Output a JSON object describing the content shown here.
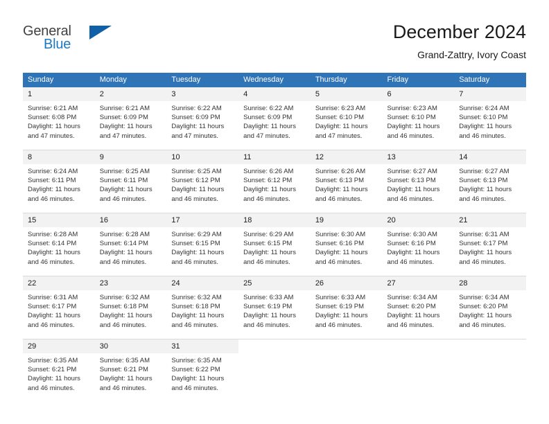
{
  "brand": {
    "name_top": "General",
    "name_bottom": "Blue",
    "triangle_color": "#1060a8",
    "blue_color": "#1c79c0",
    "gray_color": "#404040"
  },
  "header": {
    "title": "December 2024",
    "subtitle": "Grand-Zattry, Ivory Coast",
    "accent_color": "#3074b8",
    "daynum_band_color": "#f2f2f2"
  },
  "weekdays": [
    "Sunday",
    "Monday",
    "Tuesday",
    "Wednesday",
    "Thursday",
    "Friday",
    "Saturday"
  ],
  "labels": {
    "sunrise_prefix": "Sunrise: ",
    "sunset_prefix": "Sunset: ",
    "daylight_prefix": "Daylight: "
  },
  "weeks": [
    [
      {
        "day": "1",
        "sunrise": "Sunrise: 6:21 AM",
        "sunset": "Sunset: 6:08 PM",
        "daylight_1": "Daylight: 11 hours",
        "daylight_2": "and 47 minutes."
      },
      {
        "day": "2",
        "sunrise": "Sunrise: 6:21 AM",
        "sunset": "Sunset: 6:09 PM",
        "daylight_1": "Daylight: 11 hours",
        "daylight_2": "and 47 minutes."
      },
      {
        "day": "3",
        "sunrise": "Sunrise: 6:22 AM",
        "sunset": "Sunset: 6:09 PM",
        "daylight_1": "Daylight: 11 hours",
        "daylight_2": "and 47 minutes."
      },
      {
        "day": "4",
        "sunrise": "Sunrise: 6:22 AM",
        "sunset": "Sunset: 6:09 PM",
        "daylight_1": "Daylight: 11 hours",
        "daylight_2": "and 47 minutes."
      },
      {
        "day": "5",
        "sunrise": "Sunrise: 6:23 AM",
        "sunset": "Sunset: 6:10 PM",
        "daylight_1": "Daylight: 11 hours",
        "daylight_2": "and 47 minutes."
      },
      {
        "day": "6",
        "sunrise": "Sunrise: 6:23 AM",
        "sunset": "Sunset: 6:10 PM",
        "daylight_1": "Daylight: 11 hours",
        "daylight_2": "and 46 minutes."
      },
      {
        "day": "7",
        "sunrise": "Sunrise: 6:24 AM",
        "sunset": "Sunset: 6:10 PM",
        "daylight_1": "Daylight: 11 hours",
        "daylight_2": "and 46 minutes."
      }
    ],
    [
      {
        "day": "8",
        "sunrise": "Sunrise: 6:24 AM",
        "sunset": "Sunset: 6:11 PM",
        "daylight_1": "Daylight: 11 hours",
        "daylight_2": "and 46 minutes."
      },
      {
        "day": "9",
        "sunrise": "Sunrise: 6:25 AM",
        "sunset": "Sunset: 6:11 PM",
        "daylight_1": "Daylight: 11 hours",
        "daylight_2": "and 46 minutes."
      },
      {
        "day": "10",
        "sunrise": "Sunrise: 6:25 AM",
        "sunset": "Sunset: 6:12 PM",
        "daylight_1": "Daylight: 11 hours",
        "daylight_2": "and 46 minutes."
      },
      {
        "day": "11",
        "sunrise": "Sunrise: 6:26 AM",
        "sunset": "Sunset: 6:12 PM",
        "daylight_1": "Daylight: 11 hours",
        "daylight_2": "and 46 minutes."
      },
      {
        "day": "12",
        "sunrise": "Sunrise: 6:26 AM",
        "sunset": "Sunset: 6:13 PM",
        "daylight_1": "Daylight: 11 hours",
        "daylight_2": "and 46 minutes."
      },
      {
        "day": "13",
        "sunrise": "Sunrise: 6:27 AM",
        "sunset": "Sunset: 6:13 PM",
        "daylight_1": "Daylight: 11 hours",
        "daylight_2": "and 46 minutes."
      },
      {
        "day": "14",
        "sunrise": "Sunrise: 6:27 AM",
        "sunset": "Sunset: 6:13 PM",
        "daylight_1": "Daylight: 11 hours",
        "daylight_2": "and 46 minutes."
      }
    ],
    [
      {
        "day": "15",
        "sunrise": "Sunrise: 6:28 AM",
        "sunset": "Sunset: 6:14 PM",
        "daylight_1": "Daylight: 11 hours",
        "daylight_2": "and 46 minutes."
      },
      {
        "day": "16",
        "sunrise": "Sunrise: 6:28 AM",
        "sunset": "Sunset: 6:14 PM",
        "daylight_1": "Daylight: 11 hours",
        "daylight_2": "and 46 minutes."
      },
      {
        "day": "17",
        "sunrise": "Sunrise: 6:29 AM",
        "sunset": "Sunset: 6:15 PM",
        "daylight_1": "Daylight: 11 hours",
        "daylight_2": "and 46 minutes."
      },
      {
        "day": "18",
        "sunrise": "Sunrise: 6:29 AM",
        "sunset": "Sunset: 6:15 PM",
        "daylight_1": "Daylight: 11 hours",
        "daylight_2": "and 46 minutes."
      },
      {
        "day": "19",
        "sunrise": "Sunrise: 6:30 AM",
        "sunset": "Sunset: 6:16 PM",
        "daylight_1": "Daylight: 11 hours",
        "daylight_2": "and 46 minutes."
      },
      {
        "day": "20",
        "sunrise": "Sunrise: 6:30 AM",
        "sunset": "Sunset: 6:16 PM",
        "daylight_1": "Daylight: 11 hours",
        "daylight_2": "and 46 minutes."
      },
      {
        "day": "21",
        "sunrise": "Sunrise: 6:31 AM",
        "sunset": "Sunset: 6:17 PM",
        "daylight_1": "Daylight: 11 hours",
        "daylight_2": "and 46 minutes."
      }
    ],
    [
      {
        "day": "22",
        "sunrise": "Sunrise: 6:31 AM",
        "sunset": "Sunset: 6:17 PM",
        "daylight_1": "Daylight: 11 hours",
        "daylight_2": "and 46 minutes."
      },
      {
        "day": "23",
        "sunrise": "Sunrise: 6:32 AM",
        "sunset": "Sunset: 6:18 PM",
        "daylight_1": "Daylight: 11 hours",
        "daylight_2": "and 46 minutes."
      },
      {
        "day": "24",
        "sunrise": "Sunrise: 6:32 AM",
        "sunset": "Sunset: 6:18 PM",
        "daylight_1": "Daylight: 11 hours",
        "daylight_2": "and 46 minutes."
      },
      {
        "day": "25",
        "sunrise": "Sunrise: 6:33 AM",
        "sunset": "Sunset: 6:19 PM",
        "daylight_1": "Daylight: 11 hours",
        "daylight_2": "and 46 minutes."
      },
      {
        "day": "26",
        "sunrise": "Sunrise: 6:33 AM",
        "sunset": "Sunset: 6:19 PM",
        "daylight_1": "Daylight: 11 hours",
        "daylight_2": "and 46 minutes."
      },
      {
        "day": "27",
        "sunrise": "Sunrise: 6:34 AM",
        "sunset": "Sunset: 6:20 PM",
        "daylight_1": "Daylight: 11 hours",
        "daylight_2": "and 46 minutes."
      },
      {
        "day": "28",
        "sunrise": "Sunrise: 6:34 AM",
        "sunset": "Sunset: 6:20 PM",
        "daylight_1": "Daylight: 11 hours",
        "daylight_2": "and 46 minutes."
      }
    ],
    [
      {
        "day": "29",
        "sunrise": "Sunrise: 6:35 AM",
        "sunset": "Sunset: 6:21 PM",
        "daylight_1": "Daylight: 11 hours",
        "daylight_2": "and 46 minutes."
      },
      {
        "day": "30",
        "sunrise": "Sunrise: 6:35 AM",
        "sunset": "Sunset: 6:21 PM",
        "daylight_1": "Daylight: 11 hours",
        "daylight_2": "and 46 minutes."
      },
      {
        "day": "31",
        "sunrise": "Sunrise: 6:35 AM",
        "sunset": "Sunset: 6:22 PM",
        "daylight_1": "Daylight: 11 hours",
        "daylight_2": "and 46 minutes."
      },
      {
        "day": "",
        "sunrise": "",
        "sunset": "",
        "daylight_1": "",
        "daylight_2": ""
      },
      {
        "day": "",
        "sunrise": "",
        "sunset": "",
        "daylight_1": "",
        "daylight_2": ""
      },
      {
        "day": "",
        "sunrise": "",
        "sunset": "",
        "daylight_1": "",
        "daylight_2": ""
      },
      {
        "day": "",
        "sunrise": "",
        "sunset": "",
        "daylight_1": "",
        "daylight_2": ""
      }
    ]
  ]
}
